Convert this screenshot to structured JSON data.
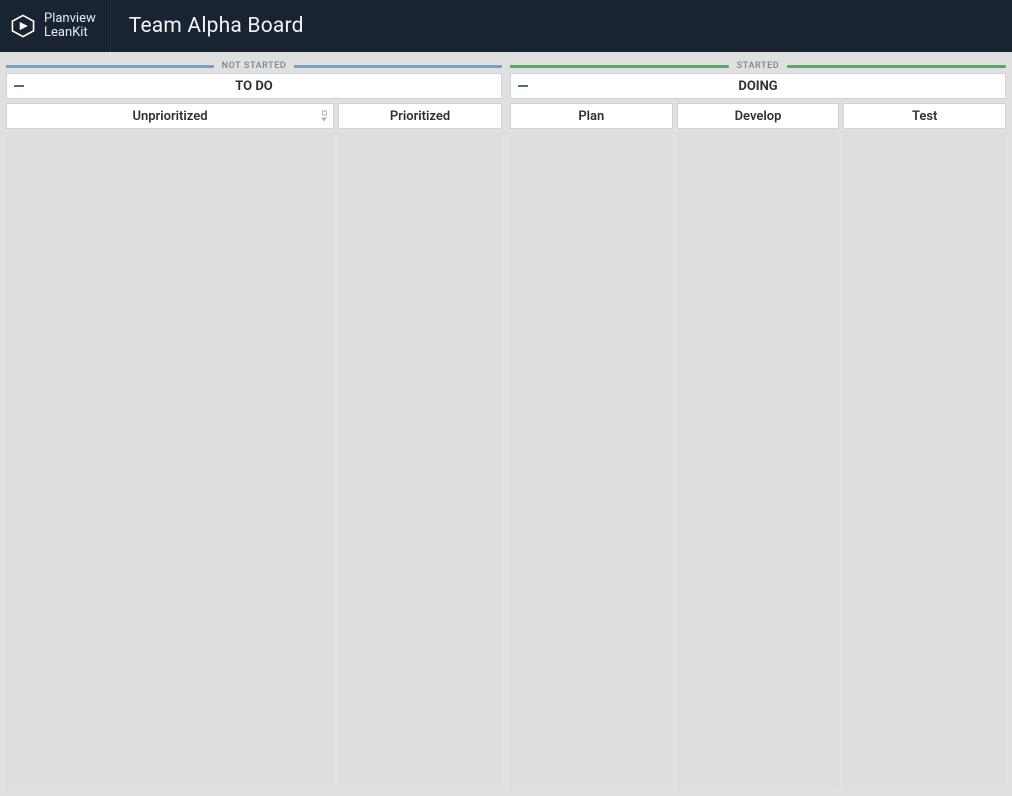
{
  "brand": {
    "line1": "Planview",
    "line2": "LeanKit"
  },
  "board_title": "Team Alpha Board",
  "lanes": {
    "not_started": {
      "phase_label": "NOT STARTED",
      "stage_label": "TO DO",
      "columns": [
        "Unprioritized",
        "Prioritized"
      ]
    },
    "started": {
      "phase_label": "STARTED",
      "stage_label": "DOING",
      "columns": [
        "Plan",
        "Develop",
        "Test"
      ]
    }
  }
}
